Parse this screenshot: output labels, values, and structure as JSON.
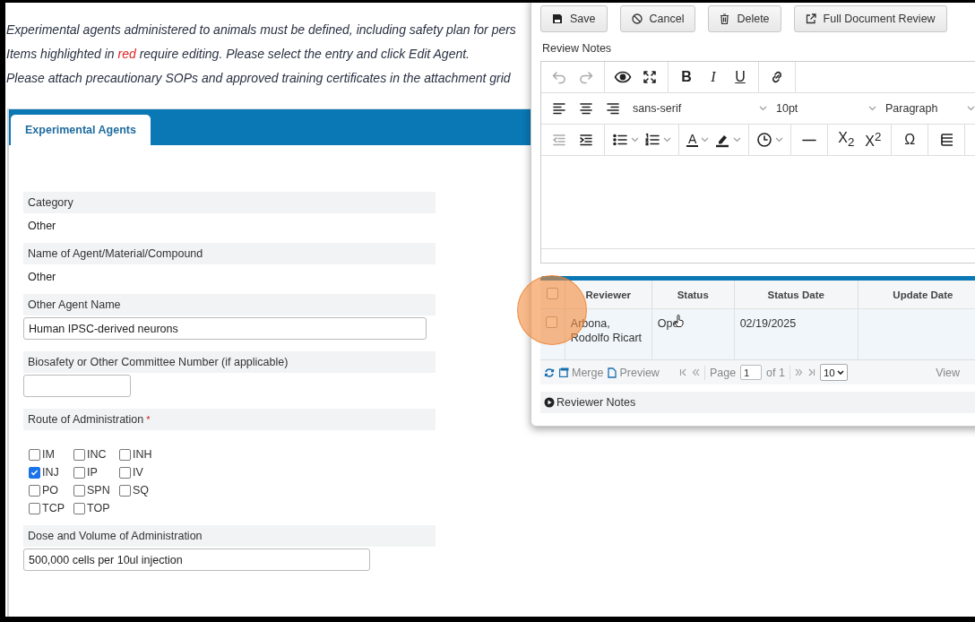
{
  "intro": [
    {
      "kind": "plain",
      "text": "Experimental agents administered to animals must be defined, including safety plan for pers"
    },
    {
      "kind": "highlighted",
      "before": "Items highlighted in ",
      "highlight": "red",
      "after": " require editing. Please select the entry and click Edit Agent."
    },
    {
      "kind": "plain",
      "text": "Please attach precautionary SOPs and approved training certificates in the attachment grid"
    }
  ],
  "tabs": [
    {
      "label": "Experimental Agents",
      "selected": true
    }
  ],
  "fields": [
    {
      "kind": "readonly",
      "label": "Category",
      "value": "Other"
    },
    {
      "kind": "readonly",
      "label": "Name of Agent/Material/Compound",
      "value": "Other"
    },
    {
      "kind": "text",
      "label": "Other Agent Name",
      "value": "Human IPSC-derived neurons"
    },
    {
      "kind": "text",
      "label": "Biosafety or Other Committee Number (if applicable)"
    },
    {
      "kind": "checkboxes",
      "label": "Route of Administration",
      "required_mark": "*",
      "options": [
        {
          "label": "IM",
          "checked": false
        },
        {
          "label": "INC",
          "checked": false
        },
        {
          "label": "INH",
          "checked": false
        },
        {
          "label": "INJ",
          "checked": true
        },
        {
          "label": "IP",
          "checked": false
        },
        {
          "label": "IV",
          "checked": false
        },
        {
          "label": "PO",
          "checked": false
        },
        {
          "label": "SPN",
          "checked": false
        },
        {
          "label": "SQ",
          "checked": false
        },
        {
          "label": "TCP",
          "checked": false
        },
        {
          "label": "TOP",
          "checked": false
        }
      ]
    },
    {
      "kind": "text",
      "label": "Dose and Volume of Administration",
      "value": "500,000 cells per 10ul injection"
    }
  ],
  "panel": {
    "buttons": [
      "Save",
      "Cancel",
      "Delete",
      "Full Document Review"
    ],
    "editor_label": "Review Notes",
    "toolbar": [
      [
        [
          {
            "kind": "icon",
            "disabled": true
          },
          {
            "kind": "icon",
            "disabled": true
          }
        ],
        [
          {
            "kind": "icon",
            "disabled": false
          },
          {
            "kind": "icon",
            "disabled": false
          }
        ],
        [
          {
            "kind": "text",
            "label": "B"
          },
          {
            "kind": "text",
            "label": "I"
          },
          {
            "kind": "text",
            "label": "U"
          }
        ],
        [
          {
            "kind": "icon",
            "disabled": false
          }
        ]
      ],
      [
        [
          {
            "kind": "icon",
            "disabled": false
          },
          {
            "kind": "icon",
            "disabled": false
          },
          {
            "kind": "icon",
            "disabled": false
          },
          {
            "kind": "select",
            "label": "sans-serif"
          },
          {
            "kind": "select",
            "label": "10pt"
          },
          {
            "kind": "select",
            "label": "Paragraph"
          }
        ]
      ],
      [
        [
          {
            "kind": "icon",
            "disabled": true
          },
          {
            "kind": "icon",
            "disabled": false
          }
        ],
        [
          {
            "kind": "split",
            "disabled": false
          },
          {
            "kind": "split",
            "disabled": false
          }
        ],
        [
          {
            "kind": "color",
            "label": "A"
          },
          {
            "kind": "split",
            "disabled": false
          }
        ],
        [
          {
            "kind": "split",
            "disabled": false
          }
        ],
        [
          {
            "kind": "icon",
            "disabled": false
          }
        ],
        [
          {
            "kind": "text",
            "label": "X$_{2}$"
          },
          {
            "kind": "text",
            "label": "X$^{2}$"
          }
        ],
        [
          {
            "kind": "text",
            "label": "Ω"
          }
        ],
        [
          {
            "kind": "icon",
            "disabled": false
          }
        ]
      ]
    ],
    "grid": {
      "header_checked": false,
      "columns": [
        "Reviewer",
        "Status",
        "Status Date",
        "Update Date"
      ],
      "rows": [
        {
          "checked": false,
          "cells": [
            "Arbona, Rodolfo Ricart",
            "Ope",
            "02/19/2025"
          ]
        }
      ]
    },
    "pager": {
      "tools": [
        "Merge",
        "Preview"
      ],
      "page_label": "Page",
      "page": "1",
      "of": "of 1",
      "page_size": "10",
      "view": "View"
    },
    "notes_toggle": "Reviewer Notes"
  }
}
